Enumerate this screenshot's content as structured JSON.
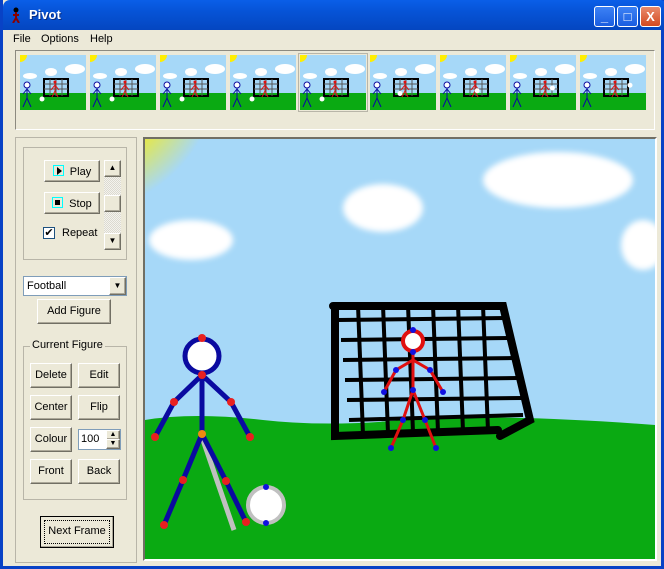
{
  "window": {
    "title": "Pivot",
    "minimize": "_",
    "maximize": "□",
    "close": "X"
  },
  "menu": {
    "file": "File",
    "options": "Options",
    "help": "Help"
  },
  "frames": {
    "count": 9,
    "selected_index": 4,
    "ball_positions": [
      [
        0.55,
        0.8
      ],
      [
        0.55,
        0.8
      ],
      [
        0.55,
        0.8
      ],
      [
        0.55,
        0.8
      ],
      [
        0.55,
        0.8
      ],
      [
        0.75,
        0.7
      ],
      [
        0.93,
        0.65
      ],
      [
        1.06,
        0.6
      ],
      [
        1.25,
        0.55
      ]
    ]
  },
  "playback": {
    "play": "Play",
    "stop": "Stop",
    "repeat_label": "Repeat",
    "repeat_checked": true
  },
  "figure_select": {
    "value": "Football",
    "add_figure": "Add Figure"
  },
  "current_figure": {
    "legend": "Current Figure",
    "delete": "Delete",
    "edit": "Edit",
    "center": "Center",
    "flip": "Flip",
    "colour": "Colour",
    "size_value": "100",
    "front": "Front",
    "back": "Back"
  },
  "next_frame": "Next Frame",
  "colors": {
    "sky": "#a6d8f8",
    "grass": "#0aaa12",
    "sun": "#ffee00",
    "blue_figure": "#0a0aa0",
    "red_figure": "#e01010",
    "joint_red": "#e82020",
    "joint_blue": "#1010e0",
    "hip_joint": "#f08a10",
    "goal": "#000000"
  }
}
